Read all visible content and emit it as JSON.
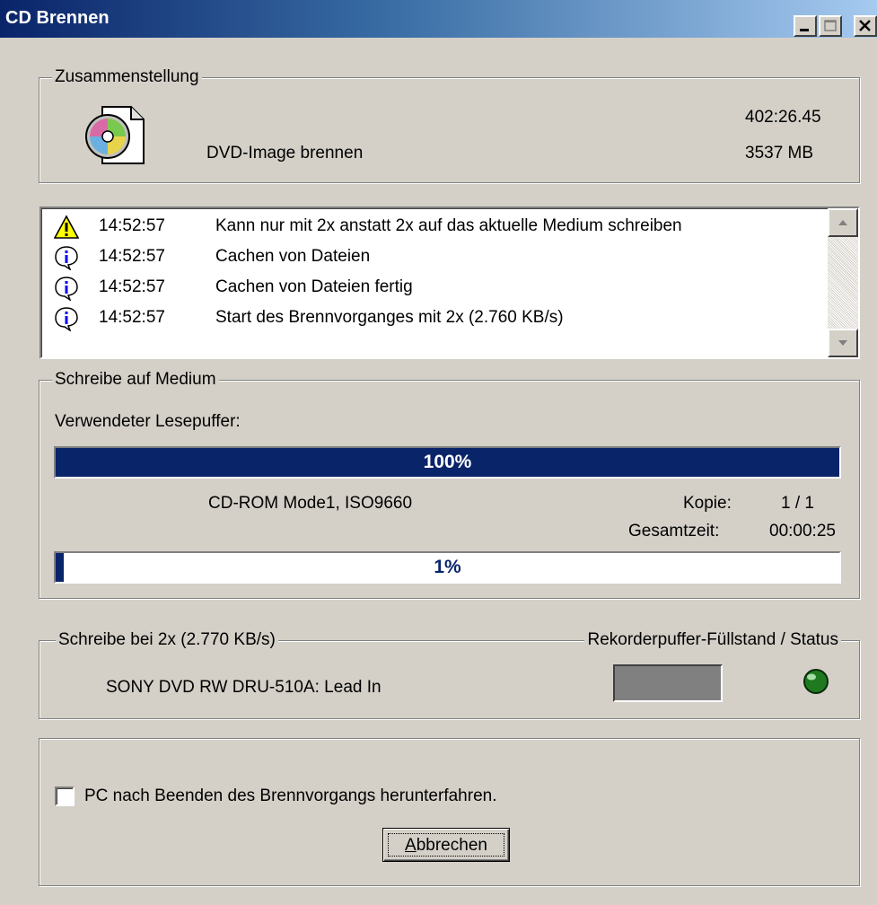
{
  "window": {
    "title": "CD Brennen"
  },
  "compilation": {
    "legend": "Zusammenstellung",
    "action": "DVD-Image brennen",
    "duration": "402:26.45",
    "size": "3537 MB"
  },
  "log": {
    "entries": [
      {
        "icon": "warning-icon",
        "time": "14:52:57",
        "message": "Kann nur mit 2x anstatt 2x auf das aktuelle Medium schreiben"
      },
      {
        "icon": "info-icon",
        "time": "14:52:57",
        "message": "Cachen von Dateien"
      },
      {
        "icon": "info-icon",
        "time": "14:52:57",
        "message": "Cachen von Dateien fertig"
      },
      {
        "icon": "info-icon",
        "time": "14:52:57",
        "message": "Start des Brennvorganges mit 2x (2.760 KB/s)"
      }
    ]
  },
  "writing": {
    "legend": "Schreibe auf Medium",
    "buffer_label": "Verwendeter Lesepuffer:",
    "buffer_progress": {
      "value": 100,
      "label": "100%"
    },
    "format": "CD-ROM Mode1, ISO9660",
    "copy_label": "Kopie:",
    "copy_value": "1 / 1",
    "total_time_label": "Gesamtzeit:",
    "total_time_value": "00:00:25",
    "write_progress": {
      "value": 1,
      "label": "1%"
    }
  },
  "recorder": {
    "legend_left": "Schreibe bei 2x (2.770 KB/s)",
    "legend_right": "Rekorderpuffer-Füllstand / Status",
    "drive_status": "SONY DVD RW DRU-510A:  Lead In",
    "status_led_color": "#1f7a1f"
  },
  "options": {
    "shutdown_label": "PC nach Beenden des Brennvorgangs herunterfahren.",
    "shutdown_checked": false,
    "cancel_button": "Abbrechen"
  },
  "colors": {
    "titlebar_start": "#0a246a",
    "progress_fill": "#0a246a",
    "dialog_bg": "#d4d0c8"
  }
}
